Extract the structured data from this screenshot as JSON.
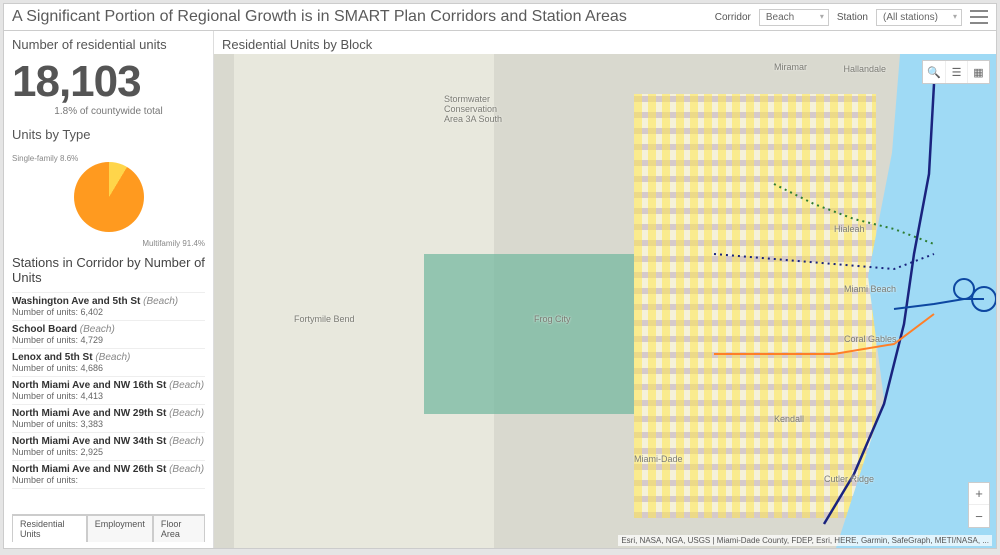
{
  "header": {
    "title": "A Significant Portion of Regional Growth is in SMART Plan Corridors and Station Areas",
    "corridor_label": "Corridor",
    "corridor_value": "Beach",
    "station_label": "Station",
    "station_value": "(All stations)"
  },
  "side": {
    "count_title": "Number of residential units",
    "count_value": "18,103",
    "count_sub": "1.8% of countywide total",
    "type_title": "Units by Type",
    "stations_title": "Stations in Corridor by Number of Units",
    "units_prefix": "Number of units: "
  },
  "chart_data": {
    "type": "pie",
    "title": "Units by Type",
    "series": [
      {
        "name": "Single-family",
        "value": 8.6,
        "label": "Single-family 8.6%"
      },
      {
        "name": "Multifamily",
        "value": 91.4,
        "label": "Multifamily 91.4%"
      }
    ]
  },
  "stations": [
    {
      "name": "Washington Ave and 5th St",
      "corridor": "Beach",
      "units": "6,402"
    },
    {
      "name": "School Board",
      "corridor": "Beach",
      "units": "4,729"
    },
    {
      "name": "Lenox and 5th St",
      "corridor": "Beach",
      "units": "4,686"
    },
    {
      "name": "North Miami Ave and NW 16th St",
      "corridor": "Beach",
      "units": "4,413"
    },
    {
      "name": "North Miami Ave and NW 29th St",
      "corridor": "Beach",
      "units": "3,383"
    },
    {
      "name": "North Miami Ave and NW 34th St",
      "corridor": "Beach",
      "units": "2,925"
    },
    {
      "name": "North Miami Ave and NW 26th St",
      "corridor": "Beach",
      "units": ""
    }
  ],
  "tabs": {
    "t1": "Residential Units",
    "t2": "Employment",
    "t3": "Floor Area"
  },
  "map": {
    "title": "Residential Units by Block",
    "attribution": "Esri, NASA, NGA, USGS | Miami-Dade County, FDEP, Esri, HERE, Garmin, SafeGraph, METI/NASA, ...",
    "places": {
      "miramar": "Miramar",
      "hallandale": "Hallandale",
      "hialeah": "Hialeah",
      "coral": "Coral Gables",
      "mbeach": "Miami Beach",
      "kendall": "Kendall",
      "cutler": "Cutler Ridge",
      "frog": "Frog City",
      "forty": "Fortymile Bend",
      "mdade": "Miami-Dade",
      "conserv": "Stormwater\nConservation\nArea 3A South"
    }
  }
}
